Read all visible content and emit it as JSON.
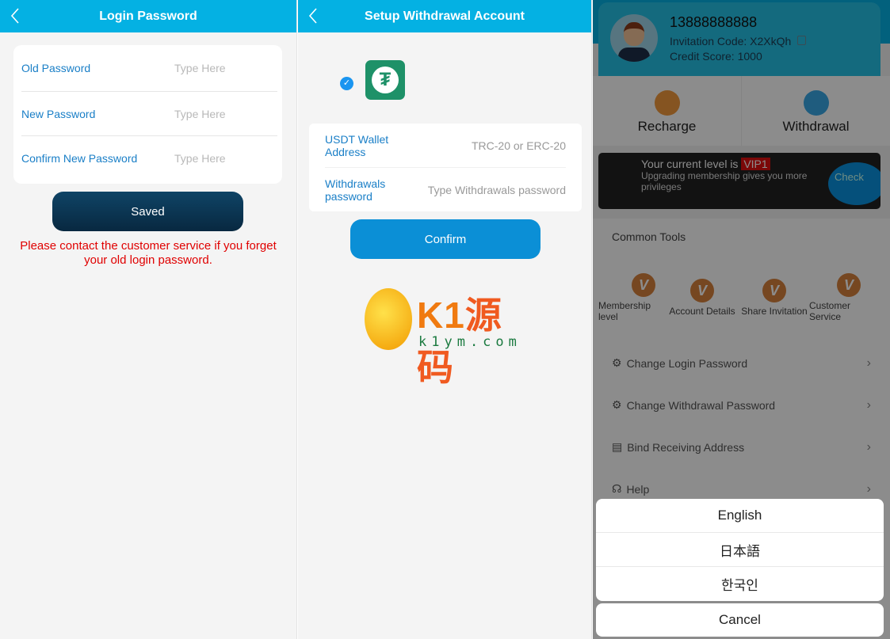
{
  "panel1": {
    "title": "Login Password",
    "fields": [
      {
        "label": "Old Password",
        "placeholder": "Type Here"
      },
      {
        "label": "New Password",
        "placeholder": "Type Here"
      },
      {
        "label": "Confirm New Password",
        "placeholder": "Type Here"
      }
    ],
    "save_label": "Saved",
    "notice": "Please contact the customer service if you forget your old login password."
  },
  "panel2": {
    "title": "Setup Withdrawal Account",
    "fields": [
      {
        "label": "USDT Wallet Address",
        "placeholder": "TRC-20 or ERC-20"
      },
      {
        "label": "Withdrawals password",
        "placeholder": "Type Withdrawals password"
      }
    ],
    "confirm_label": "Confirm",
    "watermark": {
      "brand": "K1源码",
      "domain": "k1ym.com"
    }
  },
  "panel3": {
    "phone": "13888888888",
    "invitation": "Invitation Code: X2XkQh",
    "credit": "Credit Score: 1000",
    "recharge": "Recharge",
    "withdrawal": "Withdrawal",
    "vip_prefix": "Your current level is",
    "vip_level": "VIP1",
    "vip_sub": "Upgrading membership gives you more privileges",
    "check": "Check",
    "tools_title": "Common Tools",
    "tools": [
      "Membership level",
      "Account Details",
      "Share Invitation",
      "Customer Service"
    ],
    "menu": [
      {
        "label": "Change Login Password",
        "icon": "gear-icon"
      },
      {
        "label": "Change Withdrawal Password",
        "icon": "gear-icon"
      },
      {
        "label": "Bind Receiving Address",
        "icon": "clipboard-icon"
      },
      {
        "label": "Help",
        "icon": "headset-icon"
      }
    ],
    "languages": [
      "English",
      "日本語",
      "한국인"
    ],
    "cancel": "Cancel"
  },
  "colors": {
    "header": "#04b1e3",
    "saved_button": "#0d3350",
    "confirm_button": "#0b8fd6",
    "notice": "#e00000",
    "label": "#1a7fc7"
  }
}
